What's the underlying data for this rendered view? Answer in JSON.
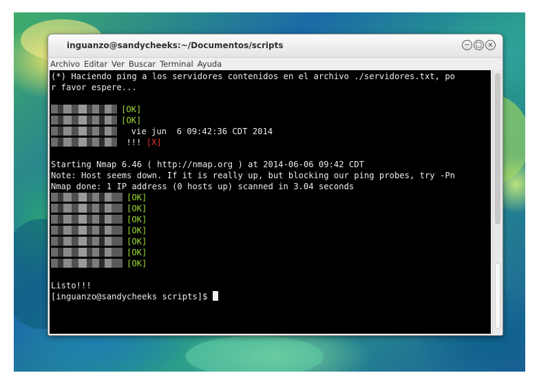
{
  "window": {
    "title": "inguanzo@sandycheeks:~/Documentos/scripts",
    "buttons": {
      "minimize": "−",
      "maximize": "□",
      "close": "×"
    }
  },
  "menu": {
    "items": [
      "Archivo",
      "Editar",
      "Ver",
      "Buscar",
      "Terminal",
      "Ayuda"
    ]
  },
  "terminal": {
    "intro_1": "(*) Haciendo ping a los servidores contenidos en el archivo ./servidores.txt, po",
    "intro_2": "r favor espere...",
    "ok": "[OK]",
    "date": "  vie jun  6 09:42:36 CDT 2014",
    "bang": " !!! ",
    "fail": "[X]",
    "nmap_1": "Starting Nmap 6.46 ( http://nmap.org ) at 2014-06-06 09:42 CDT",
    "nmap_2": "Note: Host seems down. If it is really up, but blocking our ping probes, try -Pn",
    "nmap_3": "Nmap done: 1 IP address (0 hosts up) scanned in 3.04 seconds",
    "done": "Listo!!!",
    "prompt": "[inguanzo@sandycheeks scripts]$ "
  }
}
